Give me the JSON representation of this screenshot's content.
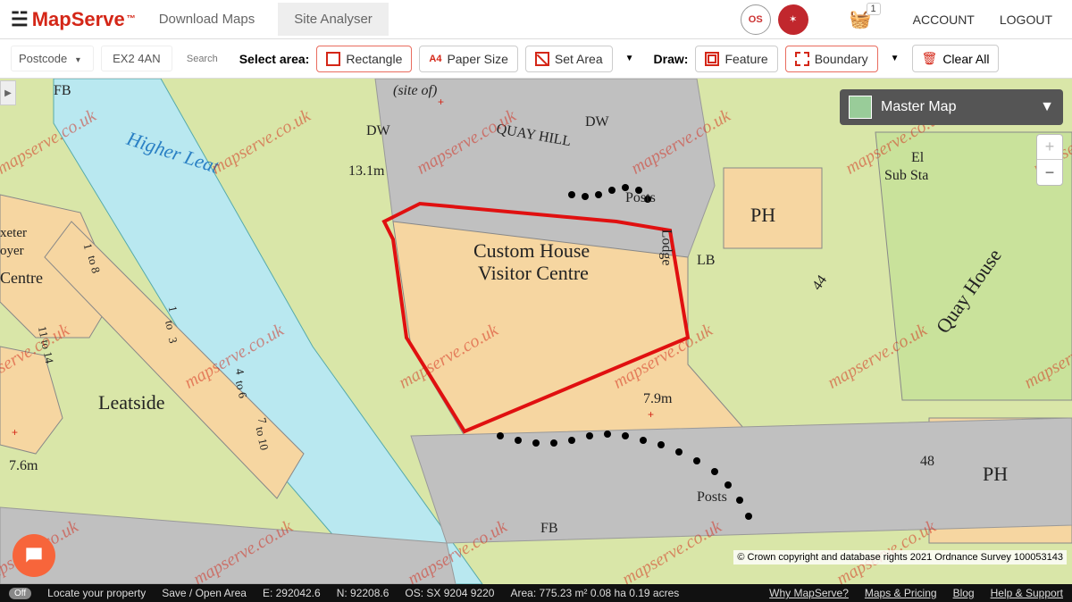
{
  "header": {
    "brand": "MapServe",
    "tm": "™",
    "tabs": [
      "Download Maps",
      "Site Analyser"
    ],
    "basket_count": "1",
    "account": "ACCOUNT",
    "logout": "LOGOUT"
  },
  "toolbar": {
    "postcode_label": "Postcode",
    "postcode_value": "EX2 4AN",
    "search": "Search",
    "select_area": "Select area:",
    "rectangle": "Rectangle",
    "paper_size": "Paper Size",
    "set_area": "Set Area",
    "draw": "Draw:",
    "feature": "Feature",
    "boundary": "Boundary",
    "clear_all": "Clear All"
  },
  "map": {
    "layer_name": "Master Map",
    "labels": {
      "custom1": "Custom House",
      "custom2": "Visitor Centre",
      "leatside": "Leatside",
      "higher_leat": "Higher Leat",
      "quay_hill": "QUAY HILL",
      "quay_house": "Quay House",
      "ph1": "PH",
      "ph2": "PH",
      "el1": "El",
      "el2": "Sub Sta",
      "lodge": "Lodge",
      "posts1": "Posts",
      "posts2": "Posts",
      "lb": "LB",
      "fb1": "FB",
      "fb2": "FB",
      "dw1": "DW",
      "dw2": "DW",
      "siteof": "(site of)",
      "m131": "13.1m",
      "m79": "7.9m",
      "m76": "7.6m",
      "n44": "44",
      "n48": "48",
      "t1": "1",
      "t8": "to 8",
      "t11": "11 to 14",
      "t13a": "1",
      "t13b": "to",
      "t13c": "3",
      "t46a": "4",
      "t46b": "to 6",
      "t10a": "7",
      "t10b": "to 10",
      "xe1": "xeter",
      "xe2": "oyer",
      "xe3": "Centre"
    },
    "watermark": "mapserve.co.uk",
    "copyright": "© Crown copyright and database rights 2021 Ordnance Survey 100053143"
  },
  "footer": {
    "toggle": "Off",
    "locate": "Locate your property",
    "save": "Save / Open Area",
    "easting": "E: 292042.6",
    "northing": "N: 92208.6",
    "os": "OS: SX 9204 9220",
    "area": "Area:  775.23 m²   0.08 ha   0.19 acres",
    "why": "Why MapServe?",
    "maps": "Maps & Pricing",
    "blog": "Blog",
    "help": "Help & Support"
  }
}
